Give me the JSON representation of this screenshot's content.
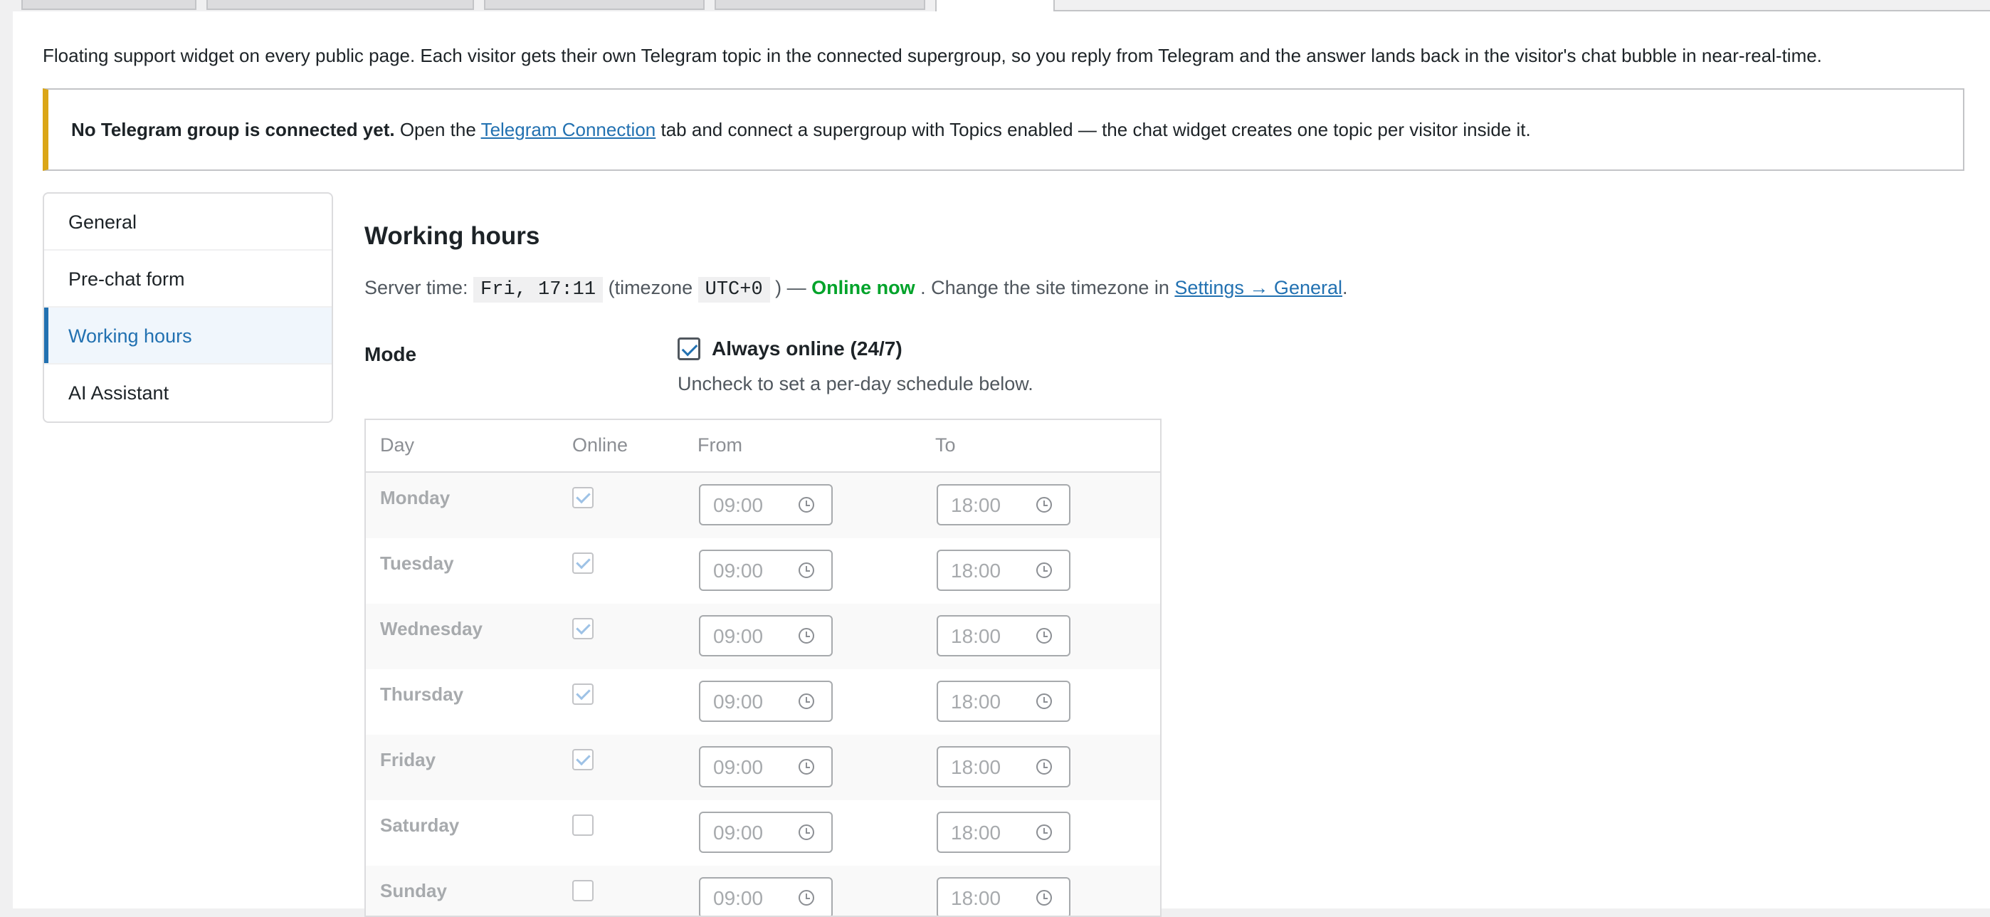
{
  "intro": "Floating support widget on every public page. Each visitor gets their own Telegram topic in the connected supergroup, so you reply from Telegram and the answer lands back in the visitor's chat bubble in near-real-time.",
  "notice": {
    "bold": "No Telegram group is connected yet.",
    "pre": " Open the ",
    "link": "Telegram Connection",
    "post": " tab and connect a supergroup with Topics enabled — the chat widget creates one topic per visitor inside it."
  },
  "sidenav": [
    {
      "label": "General",
      "active": false
    },
    {
      "label": "Pre-chat form",
      "active": false
    },
    {
      "label": "Working hours",
      "active": true
    },
    {
      "label": "AI Assistant",
      "active": false
    }
  ],
  "section": {
    "title": "Working hours",
    "server_prefix": "Server time: ",
    "server_time": "Fri, 17:11",
    "tz_prefix": " (timezone ",
    "timezone": "UTC+0",
    "tz_suffix": " ) — ",
    "status": "Online now",
    "change_prefix": " . Change the site timezone in ",
    "settings_link": "Settings → General",
    "change_suffix": "."
  },
  "mode": {
    "label": "Mode",
    "checkbox_label": "Always online (24/7)",
    "checked": true,
    "hint": "Uncheck to set a per-day schedule below."
  },
  "schedule": {
    "headers": {
      "day": "Day",
      "online": "Online",
      "from": "From",
      "to": "To"
    },
    "rows": [
      {
        "day": "Monday",
        "online": true,
        "from": "09:00",
        "to": "18:00"
      },
      {
        "day": "Tuesday",
        "online": true,
        "from": "09:00",
        "to": "18:00"
      },
      {
        "day": "Wednesday",
        "online": true,
        "from": "09:00",
        "to": "18:00"
      },
      {
        "day": "Thursday",
        "online": true,
        "from": "09:00",
        "to": "18:00"
      },
      {
        "day": "Friday",
        "online": true,
        "from": "09:00",
        "to": "18:00"
      },
      {
        "day": "Saturday",
        "online": false,
        "from": "09:00",
        "to": "18:00"
      },
      {
        "day": "Sunday",
        "online": false,
        "from": "09:00",
        "to": "18:00"
      }
    ]
  },
  "colors": {
    "accent": "#2271b1",
    "online": "#00a32a",
    "notice_border": "#dba617"
  }
}
